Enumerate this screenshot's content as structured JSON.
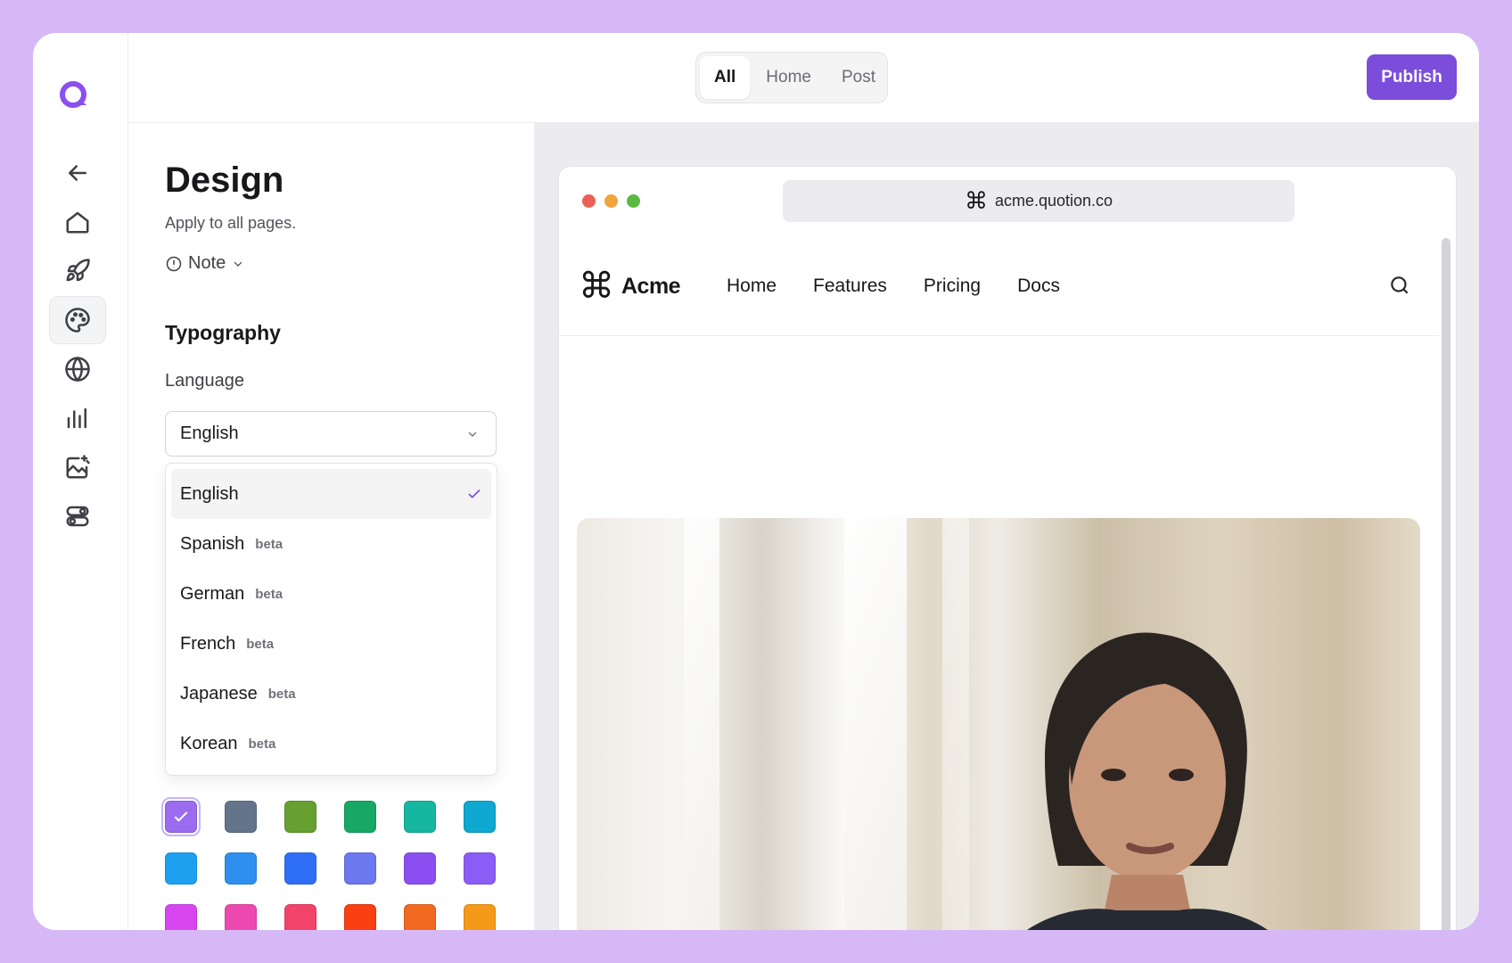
{
  "topbar": {
    "segments": [
      {
        "label": "All",
        "active": true
      },
      {
        "label": "Home",
        "active": false
      },
      {
        "label": "Post",
        "active": false
      }
    ],
    "publish_label": "Publish",
    "accent": "#7c4ddb"
  },
  "rail": {
    "items": [
      "back-icon",
      "home-icon",
      "rocket-icon",
      "palette-icon",
      "globe-icon",
      "chart-icon",
      "image-edit-icon",
      "toggles-icon"
    ],
    "active": "palette-icon"
  },
  "panel": {
    "title": "Design",
    "subtitle": "Apply to all pages.",
    "note_label": "Note",
    "section_typography": "Typography",
    "language_label": "Language",
    "language_value": "English",
    "language_options": [
      {
        "label": "English",
        "badge": "",
        "selected": true
      },
      {
        "label": "Spanish",
        "badge": "beta",
        "selected": false
      },
      {
        "label": "German",
        "badge": "beta",
        "selected": false
      },
      {
        "label": "French",
        "badge": "beta",
        "selected": false
      },
      {
        "label": "Japanese",
        "badge": "beta",
        "selected": false
      },
      {
        "label": "Korean",
        "badge": "beta",
        "selected": false
      }
    ],
    "swatch_colors": [
      "#9b6cf0",
      "#64748b",
      "#65a030",
      "#16a864",
      "#16b6a0",
      "#0ea8d0",
      "#1ea0f0",
      "#2e8fef",
      "#2f6ff6",
      "#6b78ee",
      "#8b4ff1",
      "#8b5cf6",
      "#d846ef",
      "#ec48b0",
      "#f2436a",
      "#fa3f12",
      "#f06a20",
      "#f59a18"
    ],
    "selected_swatch": 0
  },
  "preview": {
    "dots": [
      "#ec5f57",
      "#f0a43c",
      "#59b941"
    ],
    "url_icon": "⌘",
    "url": "acme.quotion.co",
    "brand_icon": "⌘",
    "brand_name": "Acme",
    "nav": [
      "Home",
      "Features",
      "Pricing",
      "Docs"
    ]
  }
}
